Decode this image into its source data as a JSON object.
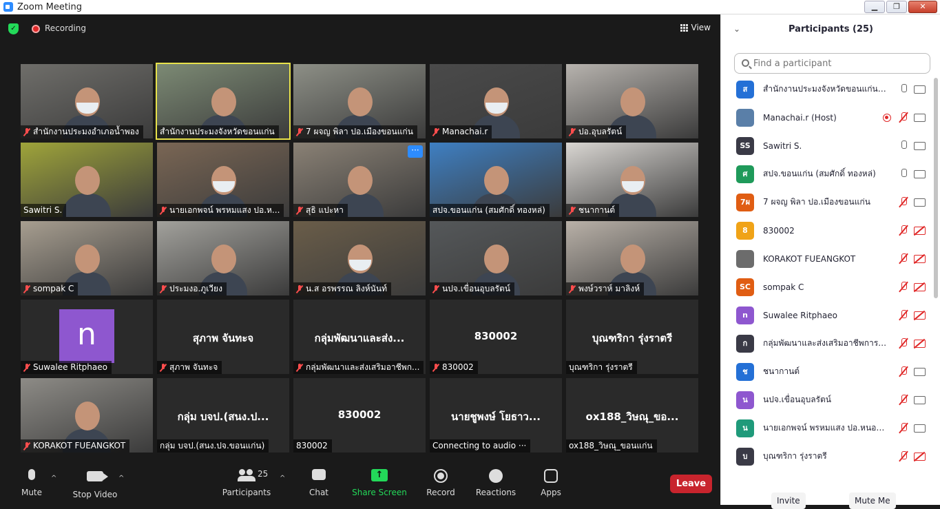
{
  "window": {
    "title": "Zoom Meeting",
    "controls": [
      "▁",
      "❐",
      "✕"
    ]
  },
  "topbar": {
    "recording_label": "Recording",
    "view_label": "View"
  },
  "tiles": [
    {
      "name": "สำนักงานประมงอำเภอน้ำพอง",
      "type": "video",
      "muted": true
    },
    {
      "name": "สำนักงานประมงจังหวัดขอนแก่น",
      "type": "video",
      "muted": false,
      "active": true
    },
    {
      "name": "7 ผจญ พิลา ปอ.เมืองขอนแก่น",
      "type": "video",
      "muted": true
    },
    {
      "name": "Manachai.r",
      "type": "video",
      "muted": true
    },
    {
      "name": "ปอ.อุบลรัตน์",
      "type": "video",
      "muted": true
    },
    {
      "name": "Sawitri S.",
      "type": "video",
      "muted": false
    },
    {
      "name": "นายเอกพจน์ พรหมแสง ปอ.ห...",
      "type": "video",
      "muted": true
    },
    {
      "name": "สุธิ แปะหา",
      "type": "video",
      "muted": true,
      "more": "···"
    },
    {
      "name": "สปจ.ขอนแก่น (สมศักดิ์ ทองหล่)",
      "type": "video",
      "muted": false
    },
    {
      "name": "ชนากานต์",
      "type": "video",
      "muted": true
    },
    {
      "name": "sompak C",
      "type": "video",
      "muted": true
    },
    {
      "name": "ประมงอ.ภูเวียง",
      "type": "video",
      "muted": true
    },
    {
      "name": "น.ส อรพรรณ ลิงห์นันท์",
      "type": "video",
      "muted": true
    },
    {
      "name": "นปจ.เขื่อนอุบลรัตน์",
      "type": "video",
      "muted": true
    },
    {
      "name": "พงษ์วราห์ มาลิงห์",
      "type": "video",
      "muted": true
    },
    {
      "name": "Suwalee Ritphaeo",
      "type": "avatar",
      "avatar_letter": "n",
      "muted": true
    },
    {
      "name": "สุภาพ จันทะจ",
      "type": "name",
      "display": "สุภาพ จันทะจ",
      "muted": true
    },
    {
      "name": "กลุ่มพัฒนาและส่งเสริมอาชีพก...",
      "type": "name",
      "display": "กลุ่มพัฒนาและส่ง...",
      "muted": true
    },
    {
      "name": "830002",
      "type": "name",
      "display": "830002",
      "muted": true
    },
    {
      "name": "บุณฑริกา รุ่งราตรี",
      "type": "name",
      "display": "บุณฑริกา รุ่งราตรี",
      "muted": false
    },
    {
      "name": "KORAKOT FUEANGKOT",
      "type": "video",
      "muted": true
    },
    {
      "name": "กลุ่ม บจป.(สนง.ปจ.ขอนแก่น)",
      "type": "name",
      "display": "กลุ่ม บจป.(สนง.ป...",
      "muted": false
    },
    {
      "name": "830002",
      "type": "name",
      "display": "830002",
      "muted": false
    },
    {
      "name": "Connecting to audio ···",
      "type": "name",
      "display": "นายชูพงษ์ โยธาว...",
      "muted": false
    },
    {
      "name": "ox188_วิษณุ_ขอนแก่น",
      "type": "name",
      "display": "ox188_วิษณุ_ขอ...",
      "muted": false
    }
  ],
  "toolbar": {
    "mute": "Mute",
    "stop_video": "Stop Video",
    "participants": "Participants",
    "participants_count": "25",
    "chat": "Chat",
    "share_screen": "Share Screen",
    "record": "Record",
    "reactions": "Reactions",
    "apps": "Apps",
    "leave": "Leave",
    "caret": "^",
    "share_arrow": "↑"
  },
  "panel": {
    "title": "Participants (25)",
    "collapse": "⌄",
    "search_placeholder": "Find a participant",
    "invite": "Invite",
    "mute_me": "Mute Me",
    "participants": [
      {
        "name": "สำนักงานประมงจังหวัดขอนแก่น (Me)",
        "initials": "ส",
        "color": "#2470d6",
        "mic": "on",
        "cam": "on"
      },
      {
        "name": "Manachai.r (Host)",
        "initials": "",
        "color": "#5a7fa8",
        "mic": "off",
        "cam": "on",
        "recording": true
      },
      {
        "name": "Sawitri S.",
        "initials": "SS",
        "color": "#3a3a46",
        "mic": "on",
        "cam": "on"
      },
      {
        "name": "สปจ.ขอนแก่น (สมศักดิ์ ทองหล่)",
        "initials": "ศ",
        "color": "#1f9a5a",
        "mic": "on",
        "cam": "on"
      },
      {
        "name": "7 ผจญ พิลา ปอ.เมืองขอนแก่น",
        "initials": "7ผ",
        "color": "#e05d13",
        "mic": "off",
        "cam": "on"
      },
      {
        "name": "830002",
        "initials": "8",
        "color": "#f0a317",
        "mic": "off",
        "cam": "off"
      },
      {
        "name": "KORAKOT FUEANGKOT",
        "initials": "",
        "color": "#6c6c6c",
        "mic": "off",
        "cam": "off"
      },
      {
        "name": "sompak C",
        "initials": "SC",
        "color": "#e05d13",
        "mic": "off",
        "cam": "off"
      },
      {
        "name": "Suwalee Ritphaeo",
        "initials": "n",
        "color": "#8e57cf",
        "mic": "off",
        "cam": "off"
      },
      {
        "name": "กลุ่มพัฒนาและส่งเสริมอาชีพการประมง",
        "initials": "ก",
        "color": "#3a3a46",
        "mic": "off",
        "cam": "off"
      },
      {
        "name": "ชนากานต์",
        "initials": "ช",
        "color": "#2470d6",
        "mic": "off",
        "cam": "on"
      },
      {
        "name": "นปจ.เขื่อนอุบลรัตน์",
        "initials": "น",
        "color": "#8e57cf",
        "mic": "off",
        "cam": "on"
      },
      {
        "name": "นายเอกพจน์ พรหมแสง ปอ.หนองสองห้อง",
        "initials": "น",
        "color": "#1f9a7a",
        "mic": "off",
        "cam": "on"
      },
      {
        "name": "บุณฑริกา รุ่งราตรี",
        "initials": "บ",
        "color": "#3a3a46",
        "mic": "off",
        "cam": "off"
      }
    ]
  }
}
